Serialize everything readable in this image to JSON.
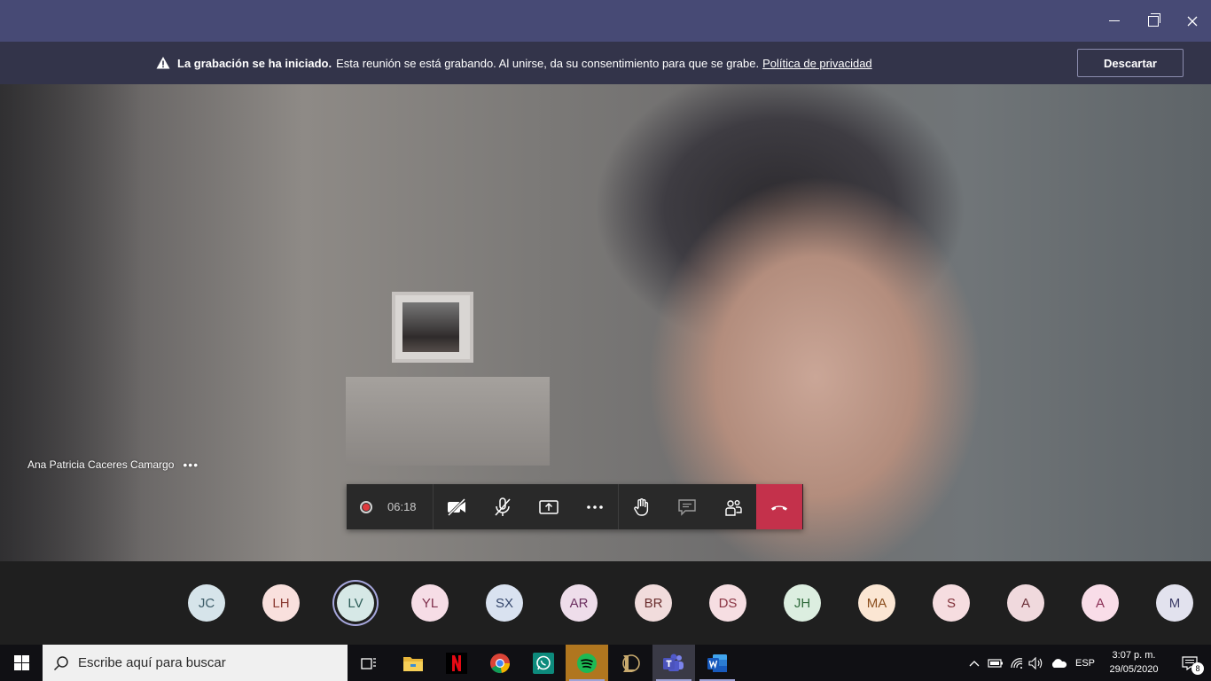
{
  "window": {
    "minimize_icon": "minimize-icon",
    "maximize_icon": "restore-icon",
    "close_icon": "close-icon"
  },
  "banner": {
    "icon": "warning-icon",
    "title": "La grabación se ha iniciado.",
    "message": "Esta reunión se está grabando. Al unirse, da su consentimiento para que se grabe.",
    "link": "Política de privacidad",
    "dismiss": "Descartar"
  },
  "video": {
    "participant_name": "Ana Patricia Caceres Camargo",
    "more_options": "•••"
  },
  "controls": {
    "recording_time": "06:18",
    "more": "•••",
    "items": [
      "camera-off-icon",
      "mic-off-icon",
      "share-screen-icon",
      "more-icon",
      "raise-hand-icon",
      "chat-icon",
      "participants-icon",
      "hang-up-icon"
    ]
  },
  "participants": [
    {
      "initials": "JC",
      "bg": "#d6e4ea",
      "fg": "#3b5a66"
    },
    {
      "initials": "LH",
      "bg": "#f9e0dd",
      "fg": "#8a3a32"
    },
    {
      "initials": "LV",
      "bg": "#d6e8e6",
      "fg": "#2d5d58",
      "active": true
    },
    {
      "initials": "YL",
      "bg": "#f6dde6",
      "fg": "#7f2f4b"
    },
    {
      "initials": "SX",
      "bg": "#d9e2f0",
      "fg": "#34466b"
    },
    {
      "initials": "AR",
      "bg": "#eeddea",
      "fg": "#6b2f5f"
    },
    {
      "initials": "BR",
      "bg": "#f1dcdc",
      "fg": "#6b2f2f"
    },
    {
      "initials": "DS",
      "bg": "#f6dee2",
      "fg": "#8a3544"
    },
    {
      "initials": "JH",
      "bg": "#dceee0",
      "fg": "#2f6a3b"
    },
    {
      "initials": "MA",
      "bg": "#fbe6d3",
      "fg": "#8a4d1c"
    },
    {
      "initials": "S",
      "bg": "#f6dde0",
      "fg": "#7f2f38"
    },
    {
      "initials": "A",
      "bg": "#f0d9dd",
      "fg": "#6b2f38"
    },
    {
      "initials": "A",
      "bg": "#f9dde8",
      "fg": "#8a2f55"
    },
    {
      "initials": "M",
      "bg": "#e2e2ee",
      "fg": "#3b3b66"
    }
  ],
  "taskbar": {
    "search_placeholder": "Escribe aquí para buscar",
    "apps": [
      "task-view-icon",
      "file-explorer-icon",
      "netflix-icon",
      "chrome-icon",
      "whatsapp-icon",
      "spotify-icon",
      "league-of-legends-icon",
      "teams-icon",
      "word-icon"
    ],
    "language": "ESP",
    "time": "3:07 p. m.",
    "date": "29/05/2020",
    "notifications": "8"
  }
}
